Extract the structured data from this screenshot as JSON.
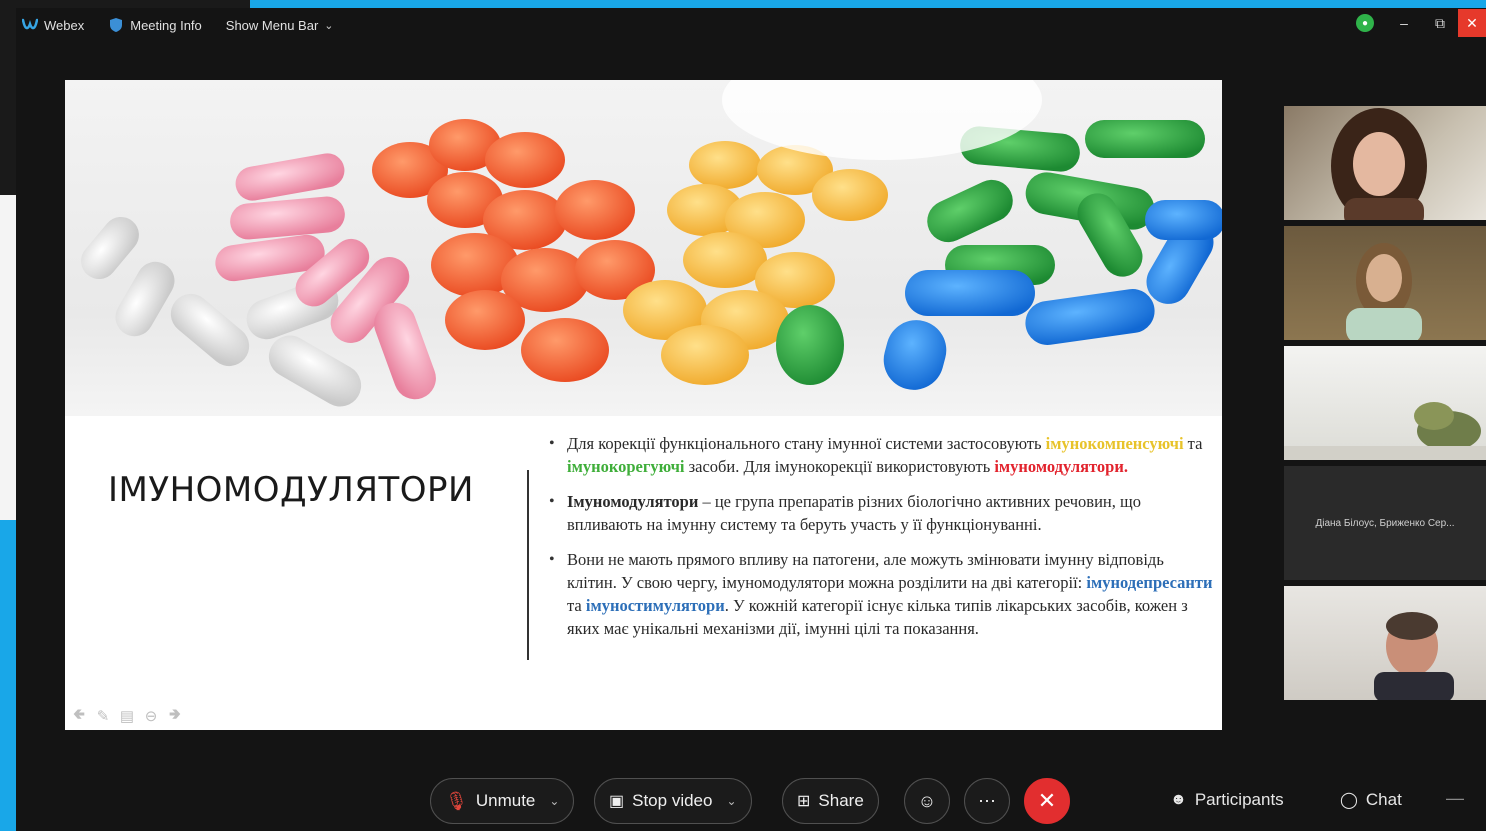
{
  "titlebar": {
    "app_name": "Webex",
    "meeting_info": "Meeting Info",
    "show_menu_bar": "Show Menu Bar"
  },
  "slide": {
    "title": "ІМУНОМОДУЛЯТОРИ",
    "bullet1": {
      "part1": "Для корекції функціонального стану імунної системи застосовують ",
      "hl_yellow": "імунокомпенсуючі",
      "part2": " та ",
      "hl_green": "імунокорегуючі",
      "part3": " засоби. Для імунокорекції використовують ",
      "hl_red": "імуномодулятори."
    },
    "bullet2": {
      "bold": "Імуномодулятори",
      "rest": " – це група препаратів різних біологічно активних речовин, що впливають на імунну систему та беруть участь у її функціонуванні."
    },
    "bullet3": {
      "part1": "Вони не мають прямого впливу на патогени, але можуть змінювати імунну відповідь клітин. У свою чергу, імуномодулятори можна розділити на дві категорії: ",
      "hl_blue1": "імунодепресанти",
      "part2": " та ",
      "hl_blue2": "імуностимулятори",
      "part3": ". У кожній категорії існує кілька типів лікарських засобів, кожен з яких має унікальні механізми дії, імунні цілі та показання."
    }
  },
  "participants": {
    "tile4_name": "Діана Білоус, Бриженко Сер..."
  },
  "controls": {
    "unmute": "Unmute",
    "stop_video": "Stop video",
    "share": "Share",
    "participants": "Participants",
    "chat": "Chat"
  },
  "colors": {
    "accent_blue": "#19a7e8",
    "end_call_red": "#e22e2f",
    "status_green": "#2fb34a"
  }
}
